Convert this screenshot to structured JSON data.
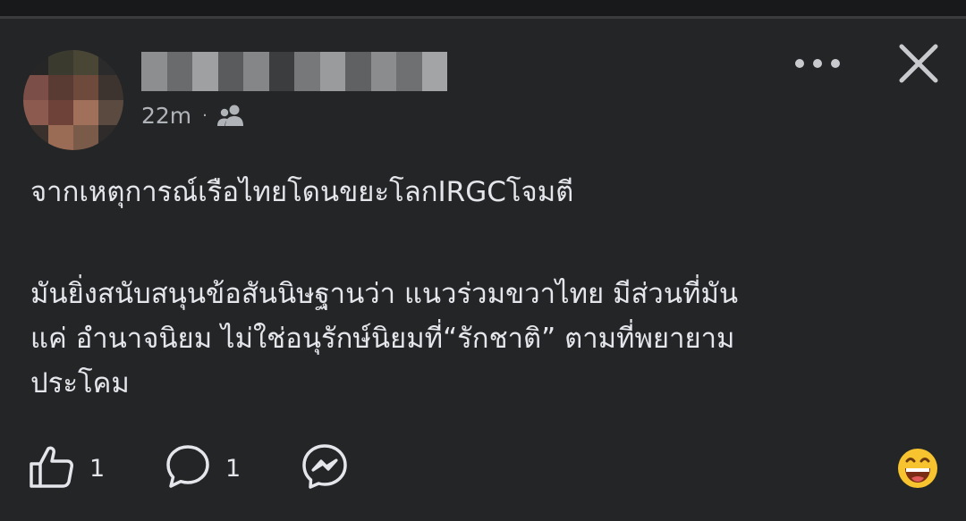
{
  "post": {
    "time": "22m",
    "separator": "·",
    "audience_icon": "friends-icon",
    "body_line_1": "จากเหตุการณ์เรือไทยโดนขยะโลกIRGCโจมตี",
    "body_line_2": "มันยิ่งสนับสนุนข้อสันนิษฐานว่า แนวร่วมขวาไทย มีส่วนที่มัน",
    "body_line_3": "แค่ อำนาจนิยม ไม่ใช่อนุรักษ์นิยมที่“รักชาติ” ตามที่พยายาม",
    "body_line_4": "ประโคม"
  },
  "header": {
    "more_icon": "more-options-icon",
    "close_icon": "close-icon"
  },
  "actions": {
    "like_count": "1",
    "comment_count": "1",
    "like_icon": "thumbs-up-icon",
    "comment_icon": "comment-icon",
    "share_icon": "messenger-icon",
    "reaction_icon": "grinning-emoji-icon"
  },
  "colors": {
    "background": "#242526",
    "text": "#e4e6eb",
    "secondary_text": "#b0b3b8",
    "icon": "#e4e6eb"
  }
}
